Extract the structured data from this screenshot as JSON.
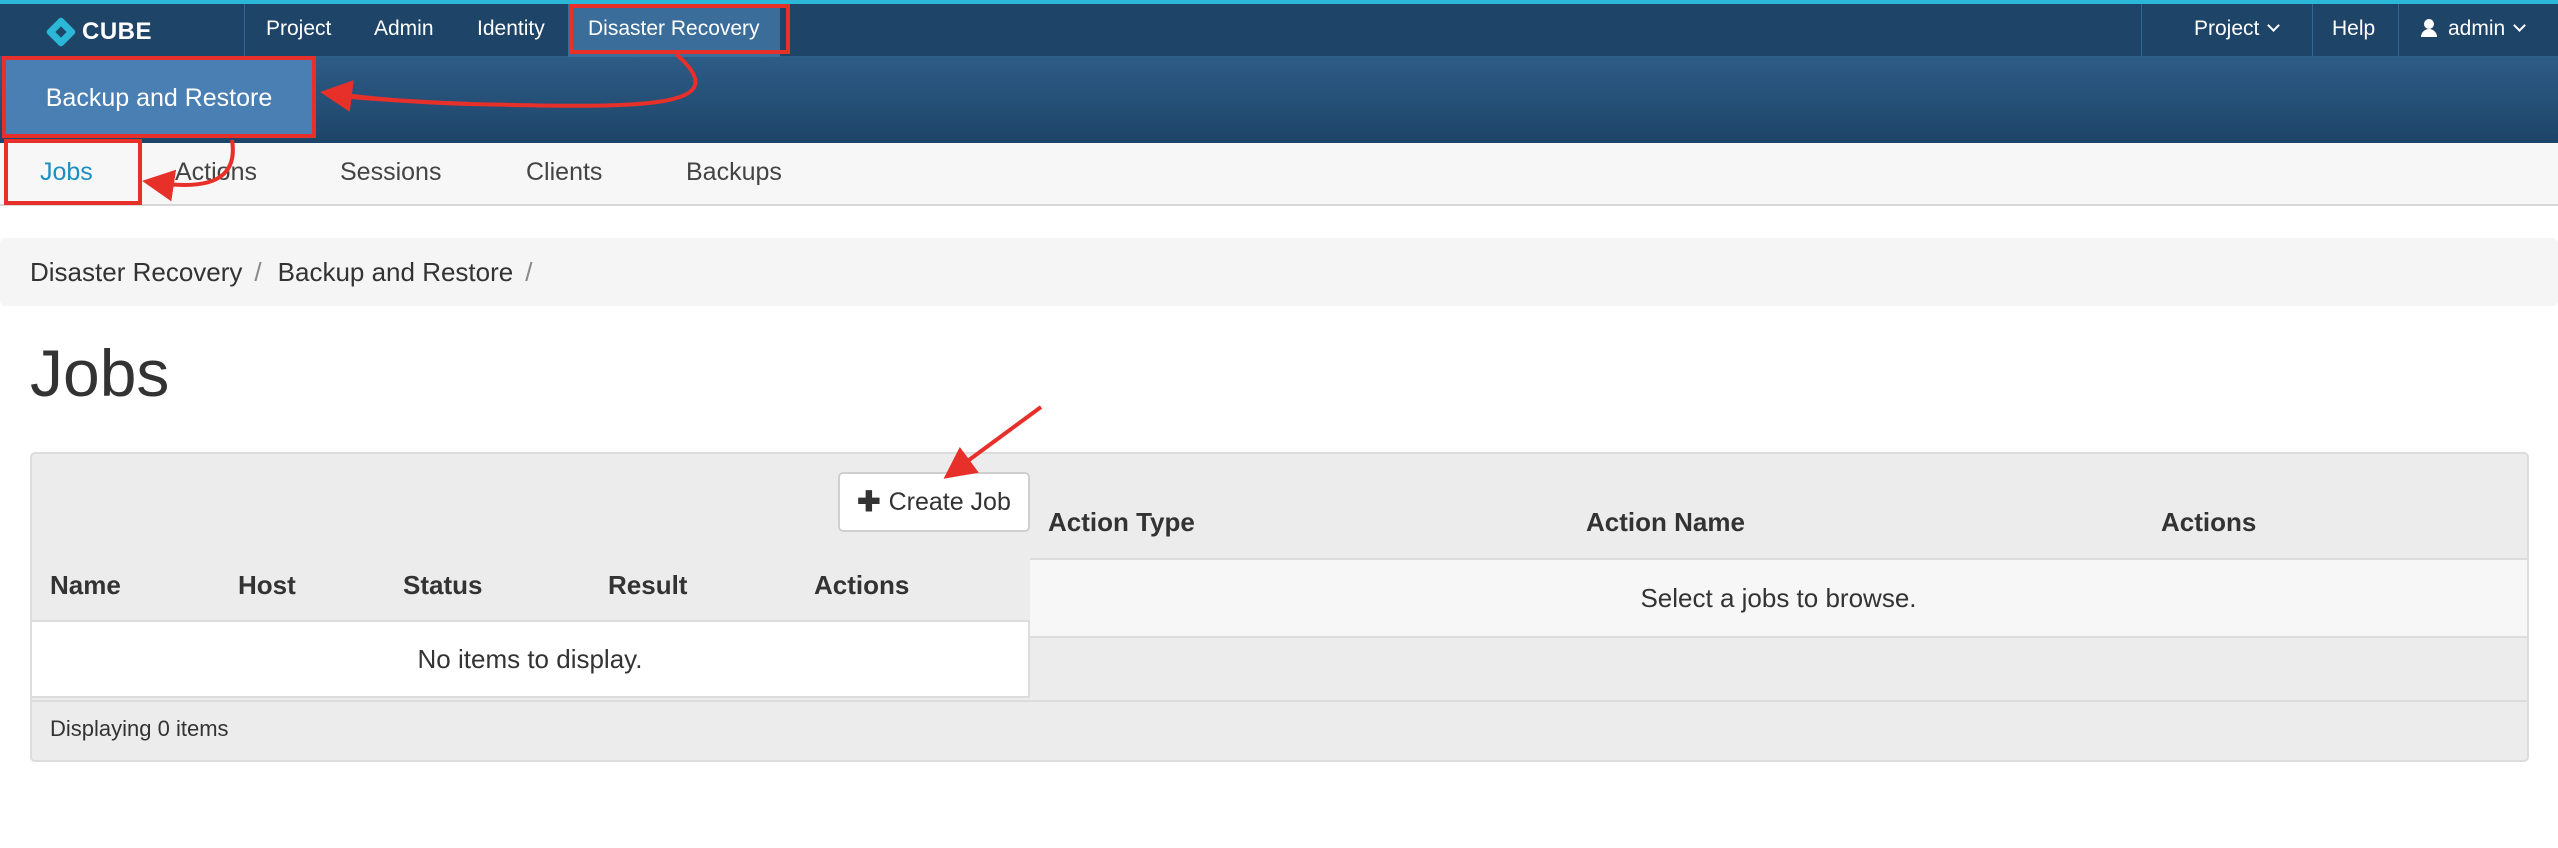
{
  "brand": {
    "name": "CUBE"
  },
  "topnav": {
    "items": [
      {
        "label": "Project"
      },
      {
        "label": "Admin"
      },
      {
        "label": "Identity"
      },
      {
        "label": "Disaster Recovery"
      }
    ],
    "right": {
      "project_label": "Project",
      "help_label": "Help",
      "user_label": "admin"
    }
  },
  "subnav": {
    "active_label": "Backup and Restore"
  },
  "tabs": [
    {
      "label": "Jobs"
    },
    {
      "label": "Actions"
    },
    {
      "label": "Sessions"
    },
    {
      "label": "Clients"
    },
    {
      "label": "Backups"
    }
  ],
  "breadcrumb": [
    {
      "label": "Disaster Recovery",
      "sep": "/"
    },
    {
      "label": "Backup and Restore",
      "sep": "/"
    }
  ],
  "page_title": "Jobs",
  "jobs_table": {
    "create_label": "Create Job",
    "columns": [
      "Name",
      "Host",
      "Status",
      "Result",
      "Actions"
    ],
    "empty_text": "No items to display."
  },
  "actions_table": {
    "columns": [
      "Action Type",
      "Action Name",
      "Actions"
    ],
    "empty_text": "Select a jobs to browse."
  },
  "footer": {
    "count_text": "Displaying 0 items"
  },
  "colors": {
    "topbar": "#1e4468",
    "accent": "#2ab7d8",
    "active_tab": "#1b8fc4",
    "annotation": "#e8302a"
  }
}
